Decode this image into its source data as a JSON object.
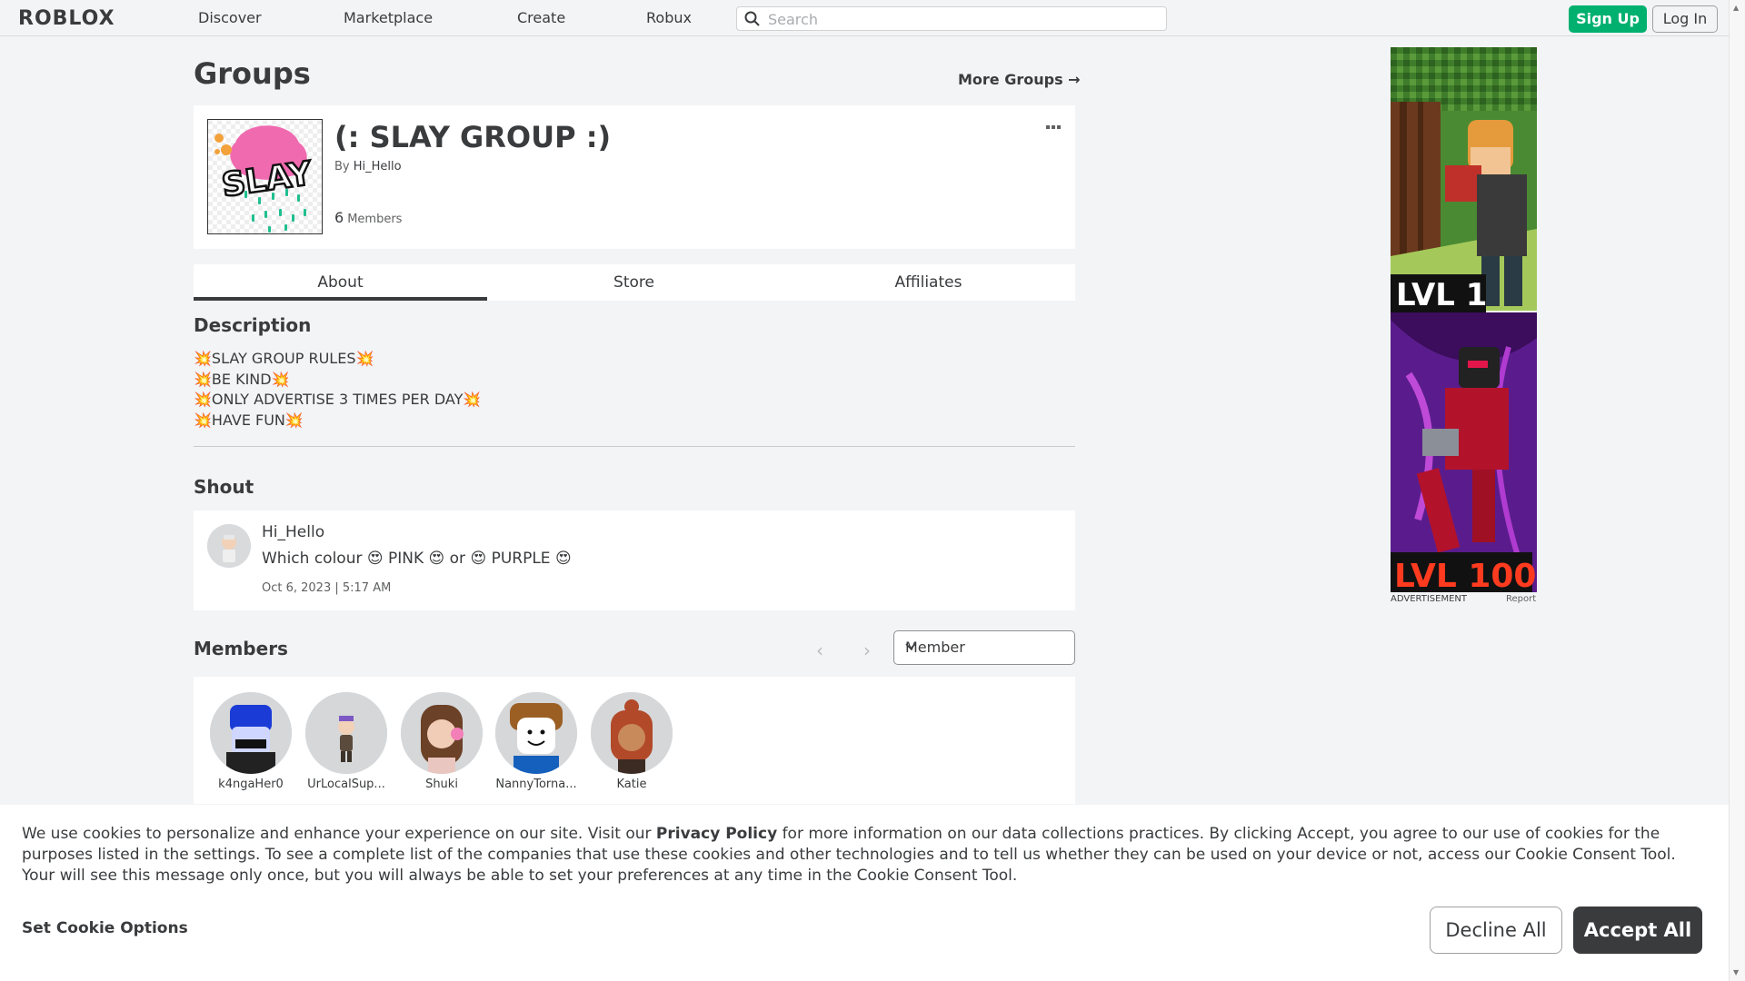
{
  "nav": {
    "logo": "ROBLOX",
    "links": [
      "Discover",
      "Marketplace",
      "Create",
      "Robux"
    ],
    "search_placeholder": "Search",
    "signup_label": "Sign Up",
    "login_label": "Log In"
  },
  "page": {
    "title": "Groups",
    "more_groups": "More Groups →"
  },
  "group": {
    "name": "(: SLAY GROUP :)",
    "by_prefix": "By",
    "owner": "Hi_Hello",
    "member_count": "6",
    "member_label": "Members",
    "emblem_text": "SLAY"
  },
  "tabs": [
    "About",
    "Store",
    "Affiliates"
  ],
  "description": {
    "title": "Description",
    "lines": [
      "💥SLAY GROUP RULES💥",
      "💥BE KIND💥",
      "💥ONLY ADVERTISE 3 TIMES PER DAY💥",
      "💥HAVE FUN💥"
    ]
  },
  "shout": {
    "title": "Shout",
    "user": "Hi_Hello",
    "text": "Which colour 😍 PINK 😍 or 😍 PURPLE 😍",
    "date": "Oct 6, 2023 | 5:17 AM"
  },
  "members": {
    "title": "Members",
    "role_selected": "Member",
    "list": [
      {
        "name": "k4ngaHer0",
        "color": "#1c2a6e"
      },
      {
        "name": "UrLocalSup...",
        "color": "#c8c8c8"
      },
      {
        "name": "Shuki",
        "color": "#8a5a3c"
      },
      {
        "name": "NannyTorna...",
        "color": "#9b5f24"
      },
      {
        "name": "Katie",
        "color": "#b24a2a"
      }
    ]
  },
  "ad": {
    "lvl1": "LVL 1",
    "lvl100": "LVL 100",
    "label": "ADVERTISEMENT",
    "report": "Report"
  },
  "cookie": {
    "text_before": "We use cookies to personalize and enhance your experience on our site. Visit our ",
    "privacy_link": "Privacy Policy",
    "text_after": " for more information on our data collections practices. By clicking Accept, you agree to our use of cookies for the purposes listed in the settings. To see a complete list of the companies that use these cookies and other technologies and to tell us whether they can be used on your device or not, access our Cookie Consent Tool. Your will see this message only once, but you will always be able to set your preferences at any time in the Cookie Consent Tool.",
    "options_label": "Set Cookie Options",
    "decline_label": "Decline All",
    "accept_label": "Accept All"
  },
  "colors": {
    "accent_green": "#00b06f",
    "text": "#393b3d",
    "background": "#f2f4f5"
  }
}
